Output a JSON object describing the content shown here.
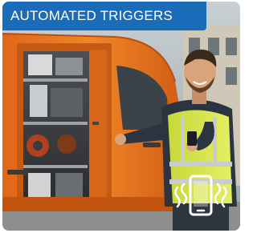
{
  "banner": {
    "title": "AUTOMATED TRIGGERS"
  },
  "icons": {
    "phone": "vibrating-smartphone-icon"
  },
  "colors": {
    "banner_bg": "#1a6bb8",
    "banner_text": "#ffffff",
    "van_orange": "#e8731c",
    "vest_yellow": "#d9e84a"
  }
}
